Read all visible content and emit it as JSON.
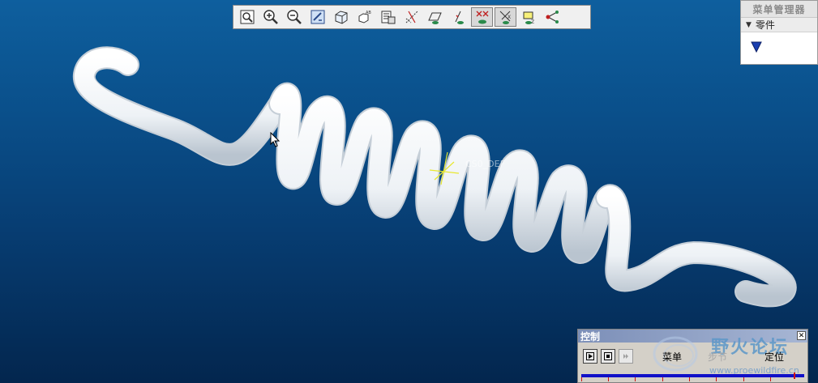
{
  "viewport": {
    "background_top": "#0e5f9e",
    "background_bottom": "#03264e",
    "model": "spring-coil",
    "coordinate_label": "CS0_DEF"
  },
  "toolbar": {
    "buttons": [
      {
        "icon": "refit-icon"
      },
      {
        "icon": "zoom-in-icon"
      },
      {
        "icon": "zoom-out-icon"
      },
      {
        "icon": "repaint-icon"
      },
      {
        "icon": "shading-icon"
      },
      {
        "icon": "saved-views-icon"
      },
      {
        "icon": "layers-icon"
      },
      {
        "icon": "datum-axes-icon"
      },
      {
        "icon": "datum-planes-icon"
      },
      {
        "icon": "datum-points-icon"
      },
      {
        "icon": "coord-sys-icon",
        "active": true
      },
      {
        "icon": "annotations-icon",
        "active": true
      },
      {
        "icon": "spin-center-icon"
      },
      {
        "icon": "network-icon"
      }
    ]
  },
  "menu_manager": {
    "title": "菜单管理器",
    "section": "零件"
  },
  "control": {
    "title": "控制",
    "menu_label": "菜单",
    "step_label": "步节",
    "position_label": "定位",
    "watermark_text": "野火论坛",
    "watermark_url": "www.proewildfire.cn"
  },
  "colors": {
    "spring": "#ffffff",
    "accent_marker": "#1a3fb0",
    "timeline": "#1010c8",
    "timeline_tick": "#d01010"
  }
}
